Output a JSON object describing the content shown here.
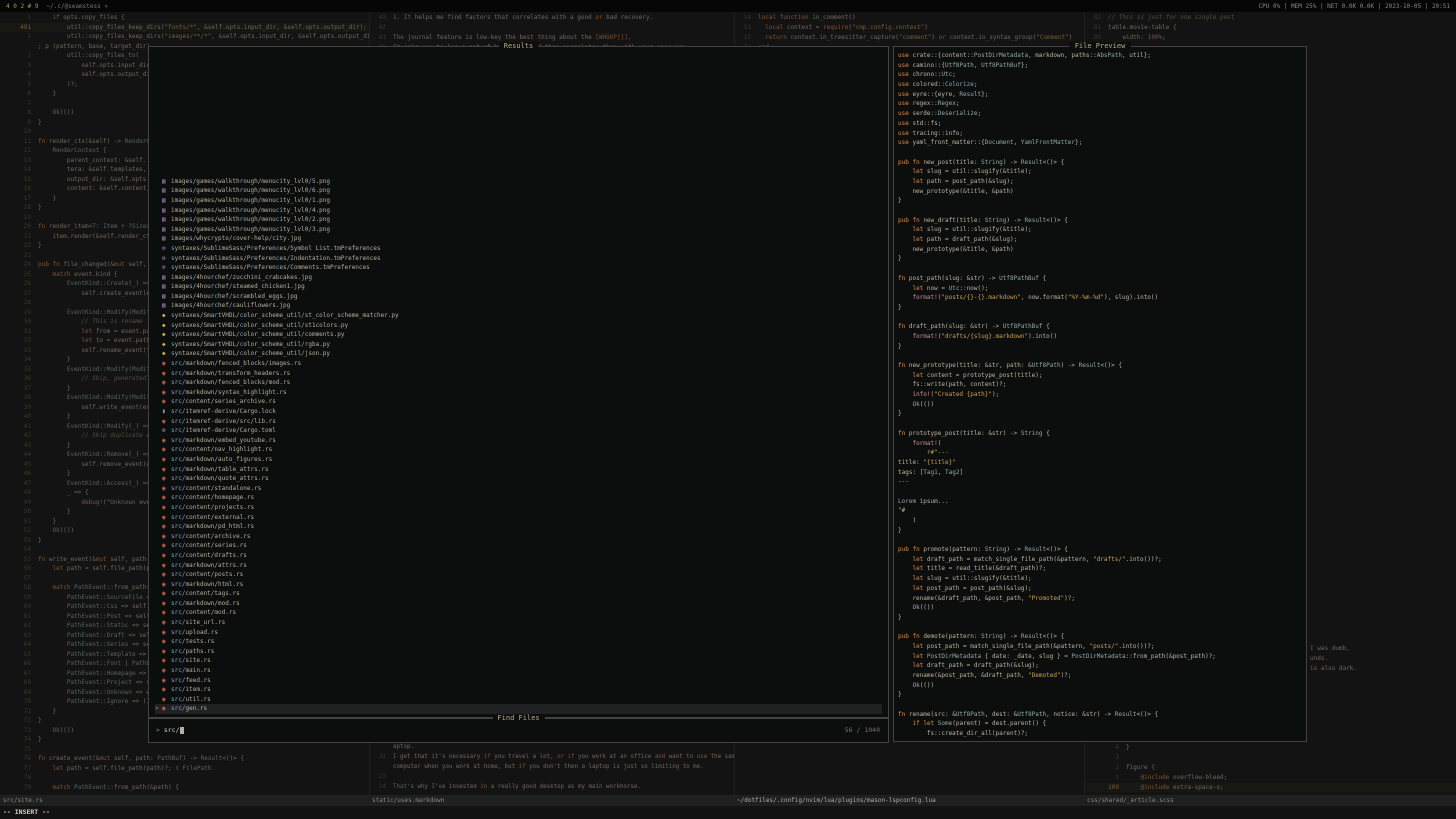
{
  "tmux": {
    "windows": "4 0 2 # 9",
    "session_path": "~/.c/@seamstess »",
    "right": "CPU 0% | MEM 25% | NET 0.0K 0.0K | 2023-10-05 | 20:51"
  },
  "finder": {
    "results_title": "Results",
    "prompt_title": "Find Files",
    "preview_title": "File Preview",
    "prompt_marker": ">",
    "query": "src/",
    "counter": "56 / 1040",
    "selected_index": 55,
    "results": [
      {
        "icon": "img",
        "path": "images/games/walkthrough/menucity_lvl0/5.png"
      },
      {
        "icon": "img",
        "path": "images/games/walkthrough/menucity_lvl0/6.png"
      },
      {
        "icon": "img",
        "path": "images/games/walkthrough/menucity_lvl0/1.png"
      },
      {
        "icon": "img",
        "path": "images/games/walkthrough/menucity_lvl0/4.png"
      },
      {
        "icon": "img",
        "path": "images/games/walkthrough/menucity_lvl0/2.png"
      },
      {
        "icon": "img",
        "path": "images/games/walkthrough/menucity_lvl0/3.png"
      },
      {
        "icon": "img",
        "path": "images/whycrypto/cover-help/city.jpg"
      },
      {
        "icon": "conf",
        "path": "syntaxes/SublimeSass/Preferences/Symbol List.tmPreferences"
      },
      {
        "icon": "conf",
        "path": "syntaxes/SublimeSass/Preferences/Indentation.tmPreferences"
      },
      {
        "icon": "conf",
        "path": "syntaxes/SublimeSass/Preferences/Comments.tmPreferences"
      },
      {
        "icon": "img",
        "path": "images/4hourchef/zucchini_crabcakes.jpg"
      },
      {
        "icon": "img",
        "path": "images/4hourchef/steamed_chicken1.jpg"
      },
      {
        "icon": "img",
        "path": "images/4hourchef/scrambled_eggs.jpg"
      },
      {
        "icon": "img",
        "path": "images/4hourchef/cauliflowers.jpg"
      },
      {
        "icon": "py",
        "path": "syntaxes/SmartVHDL/color_scheme_util/st_color_scheme_matcher.py"
      },
      {
        "icon": "py",
        "path": "syntaxes/SmartVHDL/color_scheme_util/st1colors.py"
      },
      {
        "icon": "py",
        "path": "syntaxes/SmartVHDL/color_scheme_util/comments.py"
      },
      {
        "icon": "py",
        "path": "syntaxes/SmartVHDL/color_scheme_util/rgba.py"
      },
      {
        "icon": "py",
        "path": "syntaxes/SmartVHDL/color_scheme_util/json.py"
      },
      {
        "icon": "rs",
        "path": "src/markdown/fenced_blocks/images.rs"
      },
      {
        "icon": "rs",
        "path": "src/markdown/transform_headers.rs"
      },
      {
        "icon": "rs",
        "path": "src/markdown/fenced_blocks/mod.rs"
      },
      {
        "icon": "rs",
        "path": "src/markdown/syntax_highlight.rs"
      },
      {
        "icon": "rs",
        "path": "src/content/series_archive.rs"
      },
      {
        "icon": "lock",
        "path": "src/itemref-derive/Cargo.lock"
      },
      {
        "icon": "rs",
        "path": "src/itemref-derive/src/lib.rs"
      },
      {
        "icon": "toml",
        "path": "src/itemref-derive/Cargo.toml"
      },
      {
        "icon": "rs",
        "path": "src/markdown/embed_youtube.rs"
      },
      {
        "icon": "rs",
        "path": "src/content/nav_highlight.rs"
      },
      {
        "icon": "rs",
        "path": "src/markdown/auto_figures.rs"
      },
      {
        "icon": "rs",
        "path": "src/markdown/table_attrs.rs"
      },
      {
        "icon": "rs",
        "path": "src/markdown/quote_attrs.rs"
      },
      {
        "icon": "rs",
        "path": "src/content/standalone.rs"
      },
      {
        "icon": "rs",
        "path": "src/content/homepage.rs"
      },
      {
        "icon": "rs",
        "path": "src/content/projects.rs"
      },
      {
        "icon": "rs",
        "path": "src/content/external.rs"
      },
      {
        "icon": "rs",
        "path": "src/markdown/pd_html.rs"
      },
      {
        "icon": "rs",
        "path": "src/content/archive.rs"
      },
      {
        "icon": "rs",
        "path": "src/content/series.rs"
      },
      {
        "icon": "rs",
        "path": "src/content/drafts.rs"
      },
      {
        "icon": "rs",
        "path": "src/markdown/attrs.rs"
      },
      {
        "icon": "rs",
        "path": "src/content/posts.rs"
      },
      {
        "icon": "rs",
        "path": "src/markdown/html.rs"
      },
      {
        "icon": "rs",
        "path": "src/content/tags.rs"
      },
      {
        "icon": "rs",
        "path": "src/markdown/mod.rs"
      },
      {
        "icon": "rs",
        "path": "src/content/mod.rs"
      },
      {
        "icon": "rs",
        "path": "src/site_url.rs"
      },
      {
        "icon": "rs",
        "path": "src/upload.rs"
      },
      {
        "icon": "rs",
        "path": "src/tests.rs"
      },
      {
        "icon": "rs",
        "path": "src/paths.rs"
      },
      {
        "icon": "rs",
        "path": "src/site.rs"
      },
      {
        "icon": "rs",
        "path": "src/main.rs"
      },
      {
        "icon": "rs",
        "path": "src/feed.rs"
      },
      {
        "icon": "rs",
        "path": "src/item.rs"
      },
      {
        "icon": "rs",
        "path": "src/util.rs"
      },
      {
        "icon": "rs",
        "path": "src/gen.rs"
      }
    ]
  },
  "icon_map": {
    "img": {
      "glyph": "▨",
      "color": "#b58fc9"
    },
    "conf": {
      "glyph": "⚙",
      "color": "#8f86b5"
    },
    "py": {
      "glyph": "◆",
      "color": "#d3b249"
    },
    "rs": {
      "glyph": "◉",
      "color": "#cf6a4f"
    },
    "lock": {
      "glyph": "▮",
      "color": "#9a9a94"
    },
    "toml": {
      "glyph": "⚙",
      "color": "#9a9a94"
    }
  },
  "preview_lines": [
    "use crate::{content::PostDirMetadata, markdown, paths::AbsPath, util};",
    "use camino::{Utf8Path, Utf8PathBuf};",
    "use chrono::Utc;",
    "use colored::Colorize;",
    "use eyre::{eyre, Result};",
    "use regex::Regex;",
    "use serde::Deserialize;",
    "use std::fs;",
    "use tracing::info;",
    "use yaml_front_matter::{Document, YamlFrontMatter};",
    "",
    "pub fn new_post(title: String) -> Result<()> {",
    "    let slug = util::slugify(&title);",
    "    let path = post_path(&slug);",
    "    new_prototype(&title, &path)",
    "}",
    "",
    "pub fn new_draft(title: String) -> Result<()> {",
    "    let slug = util::slugify(&title);",
    "    let path = draft_path(&slug);",
    "    new_prototype(&title, &path)",
    "}",
    "",
    "fn post_path(slug: &str) -> Utf8PathBuf {",
    "    let now = Utc::now();",
    "    format!(\"posts/{}-{}.markdown\", now.format(\"%Y-%m-%d\"), slug).into()",
    "}",
    "",
    "fn draft_path(slug: &str) -> Utf8PathBuf {",
    "    format!(\"drafts/{slug}.markdown\").into()",
    "}",
    "",
    "fn new_prototype(title: &str, path: &Utf8Path) -> Result<()> {",
    "    let content = prototype_post(title);",
    "    fs::write(path, content)?;",
    "    info!(\"Created {path}\");",
    "    Ok(())",
    "}",
    "",
    "fn prototype_post(title: &str) -> String {",
    "    format!(",
    "        r#\"---",
    "title: \"{title}\"",
    "tags: [Tag1, Tag2]",
    "---",
    "",
    "Lorem ipsum...",
    "\"#",
    "    )",
    "}",
    "",
    "pub fn promote(pattern: String) -> Result<()> {",
    "    let draft_path = match_single_file_path(&pattern, \"drafts/\".into())?;",
    "    let title = read_title(&draft_path)?;",
    "    let slug = util::slugify(&title);",
    "    let post_path = post_path(&slug);",
    "    rename(&draft_path, &post_path, \"Promoted\")?;",
    "    Ok(())",
    "}",
    "",
    "pub fn demote(pattern: String) -> Result<()> {",
    "    let post_path = match_single_file_path(&pattern, \"posts/\".into())?;",
    "    let PostDirMetadata { date: _date, slug } = PostDirMetadata::from_path(&post_path)?;",
    "    let draft_path = draft_path(&slug);",
    "    rename(&post_path, &draft_path, \"Demoted\")?;",
    "    Ok(())",
    "}",
    "",
    "fn rename(src: &Utf8Path, dest: &Utf8Path, notice: &str) -> Result<()> {",
    "    if let Some(parent) = dest.parent() {",
    "        fs::create_dir_all(parent)?;"
  ],
  "panes": {
    "left": [
      [
        "1",
        "    if opts.copy_files {"
      ],
      [
        "491",
        "        util::copy_files_keep_dirs(\"fonts/*\", &self.opts.input_dir, &self.opts.output_dir); p",
        "cur"
      ],
      [
        "1",
        "        util::copy_files_keep_dirs(\"images/**/*\", &self.opts.input_dir, &self.opts.output_dir)?"
      ],
      [
        "",
        "; p (pattern, base, target_dir)"
      ],
      [
        "2",
        "        util::copy_files_to("
      ],
      [
        "3",
        "            self.opts.input_dir."
      ],
      [
        "4",
        "            self.opts.output_di"
      ],
      [
        "5",
        "        )?;"
      ],
      [
        "6",
        "    }"
      ],
      [
        "7",
        ""
      ],
      [
        "8",
        "    Ok(())"
      ],
      [
        "9",
        "}"
      ],
      [
        "10",
        ""
      ],
      [
        "11",
        "fn render_ctx(&self) -> RenderCo"
      ],
      [
        "12",
        "    RenderContext {"
      ],
      [
        "13",
        "        parent_context: &self."
      ],
      [
        "14",
        "        tera: &self.templates,"
      ],
      [
        "15",
        "        output_dir: &self.opts.o"
      ],
      [
        "16",
        "        content: &self.content,"
      ],
      [
        "17",
        "    }"
      ],
      [
        "18",
        "}"
      ],
      [
        "19",
        ""
      ],
      [
        "20",
        "fn render_item<T: Item + ?Sized>"
      ],
      [
        "21",
        "    item.render(&self.render_ctx"
      ],
      [
        "22",
        "}"
      ],
      [
        "23",
        ""
      ],
      [
        "24",
        "pub fn file_changed(&mut self, m"
      ],
      [
        "25",
        "    match event.kind {"
      ],
      [
        "26",
        "        EventKind::Create(_) =>"
      ],
      [
        "27",
        "            self.create_event(ev"
      ],
      [
        "28",
        ""
      ],
      [
        "29",
        "        EventKind::Modify(Modify"
      ],
      [
        "30",
        "            // This is rename"
      ],
      [
        "31",
        "            let from = event.pat"
      ],
      [
        "32",
        "            let to = event.paths"
      ],
      [
        "33",
        "            self.rename_event(fr"
      ],
      [
        "34",
        "        }"
      ],
      [
        "35",
        "        EventKind::Modify(Modify"
      ],
      [
        "36",
        "            // Skip, generated w"
      ],
      [
        "37",
        "        }"
      ],
      [
        "38",
        "        EventKind::Modify(Modify"
      ],
      [
        "39",
        "            self.write_event(eve"
      ],
      [
        "40",
        "        }"
      ],
      [
        "41",
        "        EventKind::Modify(_) =>"
      ],
      [
        "42",
        "            // Skip duplicate ev"
      ],
      [
        "43",
        "        }"
      ],
      [
        "44",
        "        EventKind::Remove(_) =>"
      ],
      [
        "45",
        "            self.remove_event(ev"
      ],
      [
        "46",
        "        }"
      ],
      [
        "47",
        "        EventKind::Access(_) =>"
      ],
      [
        "48",
        "        _ => {"
      ],
      [
        "49",
        "            debug!(\"Unknown even"
      ],
      [
        "50",
        "        }"
      ],
      [
        "51",
        "    }"
      ],
      [
        "52",
        "    Ok(())"
      ],
      [
        "53",
        "}"
      ],
      [
        "54",
        ""
      ],
      [
        "55",
        "fn write_event(&mut self, path:"
      ],
      [
        "56",
        "    let path = self.file_path(pa"
      ],
      [
        "57",
        ""
      ],
      [
        "58",
        "    match PathEvent::from_path(&"
      ],
      [
        "59",
        "        PathEvent::SourceFile =>"
      ],
      [
        "60",
        "        PathEvent::Css => self.r"
      ],
      [
        "61",
        "        PathEvent::Post => self."
      ],
      [
        "62",
        "        PathEvent::Static => sel"
      ],
      [
        "63",
        "        PathEvent::Draft => self"
      ],
      [
        "64",
        "        PathEvent::Series => sel"
      ],
      [
        "65",
        "        PathEvent::Template => s"
      ],
      [
        "66",
        "        PathEvent::Font | PathEv"
      ],
      [
        "67",
        "        PathEvent::Homepage => s"
      ],
      [
        "68",
        "        PathEvent::Project => se"
      ],
      [
        "69",
        "        PathEvent::Unknown => wa"
      ],
      [
        "70",
        "        PathEvent::Ignore => (),"
      ],
      [
        "71",
        "    }"
      ],
      [
        "72",
        "}"
      ],
      [
        "73",
        "    Ok(())"
      ],
      [
        "74",
        "}"
      ],
      [
        "75",
        ""
      ],
      [
        "76",
        "fn create_event(&mut self, path: PathBuf) -> Result<()> {"
      ],
      [
        "77",
        "    let path = self.file_path(path)?; τ FilePath"
      ],
      [
        "78",
        ""
      ],
      [
        "79",
        "    match PathEvent::from_path(&path) {"
      ]
    ],
    "top_mid": [
      [
        "43",
        "1. It helps me find factors that correlates with a good or bad recovery."
      ],
      [
        "42",
        ""
      ],
      [
        "41",
        "The journal feature is low-key the best thing about the [WHOOP][]."
      ],
      [
        "40",
        "It asks you to log a set of behaviors and then correlates them with your recovery."
      ]
    ],
    "top_right": [
      [
        "14",
        "local function in_comment()"
      ],
      [
        "13",
        "  local context = require(\"cmp.config.context\")"
      ],
      [
        "12",
        "  return context.in_treesitter_capture(\"comment\") or context.in_syntax_group(\"Comment\")"
      ],
      [
        "11",
        "end"
      ]
    ],
    "far_right_top": [
      [
        "82",
        "// This is just for one single post"
      ],
      [
        "81",
        "table.movie-table {"
      ],
      [
        "80",
        "    width: 100%;"
      ],
      [
        "79",
        ""
      ]
    ],
    "bottom_mid": [
      [
        "",
        "aptop."
      ],
      [
        "22",
        "I get that it's necessary if you travel a lot, or if you work at an office and want to use the same"
      ],
      [
        "",
        "computer when you work at home, but if you don't then a laptop is just so limiting to me."
      ],
      [
        "23",
        ""
      ],
      [
        "24",
        "That's why I've invested in a really good desktop as my main workhorse."
      ]
    ],
    "bottom_right": [
      [
        "4",
        "}"
      ],
      [
        "3",
        ""
      ],
      [
        "2",
        "figure {"
      ],
      [
        "1",
        "    @include overflow-bleed;"
      ],
      [
        "209",
        "    @include extra-space-s;",
        "cur"
      ]
    ],
    "right_fragments": [
      [
        "",
        "I was dumb,"
      ],
      [
        "",
        "unds."
      ],
      [
        "",
        "is also dark."
      ]
    ]
  },
  "statusbar": [
    "src/site.rs",
    "static/uses.markdown",
    "~/dotfiles/.config/nvim/lua/plugins/mason-lspconfig.lua",
    "css/shared/_article.scss"
  ],
  "cmdline": "-- INSERT --"
}
